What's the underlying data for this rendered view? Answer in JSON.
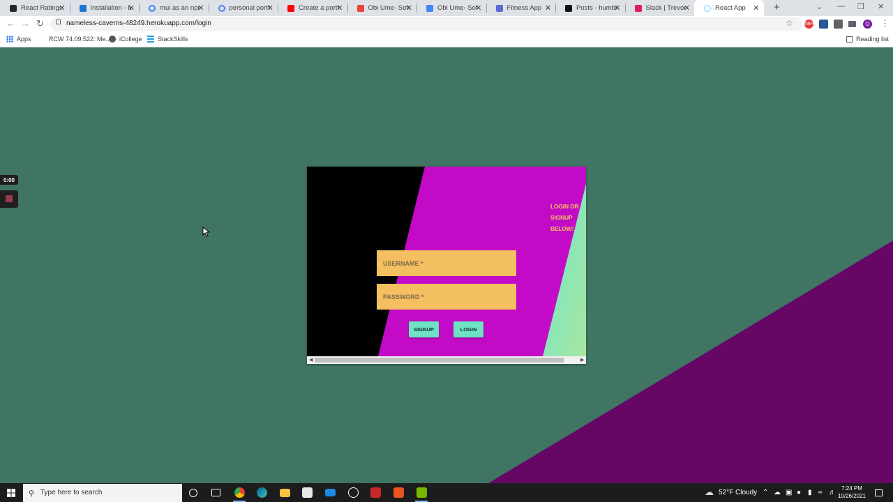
{
  "browser": {
    "tabs": [
      {
        "title": "React Ratings D",
        "icon": "github-icon",
        "color": "#24292e"
      },
      {
        "title": "Installation - M",
        "icon": "mui-icon",
        "color": "#1976d2"
      },
      {
        "title": "mui as an npm p",
        "icon": "google-icon",
        "color": "#4285f4"
      },
      {
        "title": "personal portfo",
        "icon": "google-icon",
        "color": "#4285f4"
      },
      {
        "title": "Create a portfo",
        "icon": "youtube-icon",
        "color": "#ff0000"
      },
      {
        "title": "Obi Ume- Softw",
        "icon": "gmail-icon",
        "color": "#ea4335"
      },
      {
        "title": "Obi Ume- Softw",
        "icon": "docs-icon",
        "color": "#4285f4"
      },
      {
        "title": "Fitness App",
        "icon": "gear-icon",
        "color": "#5b6bd6"
      },
      {
        "title": "Posts - humble",
        "icon": "circle-icon",
        "color": "#111111"
      },
      {
        "title": "Slack | Trevor Z",
        "icon": "slack-icon",
        "color": "#e01e5a"
      },
      {
        "title": "React App",
        "icon": "react-icon",
        "color": "#61dafb"
      }
    ],
    "new_tab": "+",
    "url": "nameless-caverns-48249.herokuapp.com/login",
    "profile_initial": "O",
    "bookmarks": [
      {
        "label": "Apps"
      },
      {
        "label": "RCW 74.09.522: Me..."
      },
      {
        "label": "iCollege"
      },
      {
        "label": "StackSkills"
      }
    ],
    "reading_list": "Reading list"
  },
  "recorder": {
    "time": "0:00"
  },
  "login": {
    "headline": "LOGIN OR SIGNUP BELOW!",
    "username_placeholder": "USERNAME *",
    "password_placeholder": "PASSWORD *",
    "signup_label": "SIGNUP",
    "login_label": "LOGIN"
  },
  "taskbar": {
    "search_placeholder": "Type here to search",
    "weather": "52°F  Cloudy",
    "time": "7:24 PM",
    "date": "10/26/2021"
  },
  "colors": {
    "page_bg": "#3f7562",
    "page_triangle": "#660766",
    "card_magenta": "#c30ac6",
    "card_black": "#000000",
    "input_bg": "#f4bf61",
    "button_bg": "#6fe2c4",
    "headline": "#f2c05c"
  }
}
